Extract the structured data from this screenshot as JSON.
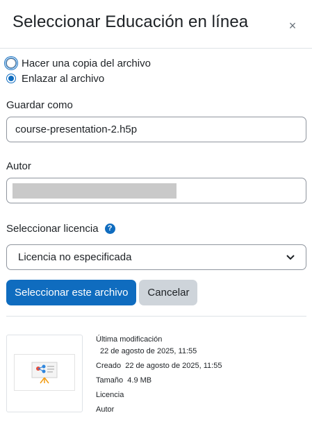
{
  "dialog": {
    "title": "Seleccionar Educación en línea",
    "close_symbol": "×"
  },
  "options": {
    "copy_label": "Hacer una copia del archivo",
    "link_label": "Enlazar al archivo",
    "selected": "link"
  },
  "form": {
    "save_as_label": "Guardar como",
    "save_as_value": "course-presentation-2.h5p",
    "author_label": "Autor",
    "author_value": "",
    "license_label": "Seleccionar licencia",
    "license_help_symbol": "?",
    "license_selected": "Licencia no especificada"
  },
  "buttons": {
    "select_label": "Seleccionar este archivo",
    "cancel_label": "Cancelar"
  },
  "file_info": {
    "modified_label": "Última modificación",
    "modified_value": "22 de agosto de 2025, 11:55",
    "created_label": "Creado",
    "created_value": "22 de agosto de 2025, 11:55",
    "size_label": "Tamaño",
    "size_value": "4.9 MB",
    "license_label": "Licencia",
    "author_label": "Autor"
  },
  "colors": {
    "primary": "#0f6cbf",
    "secondary": "#ced4da",
    "border": "#8f959e"
  }
}
